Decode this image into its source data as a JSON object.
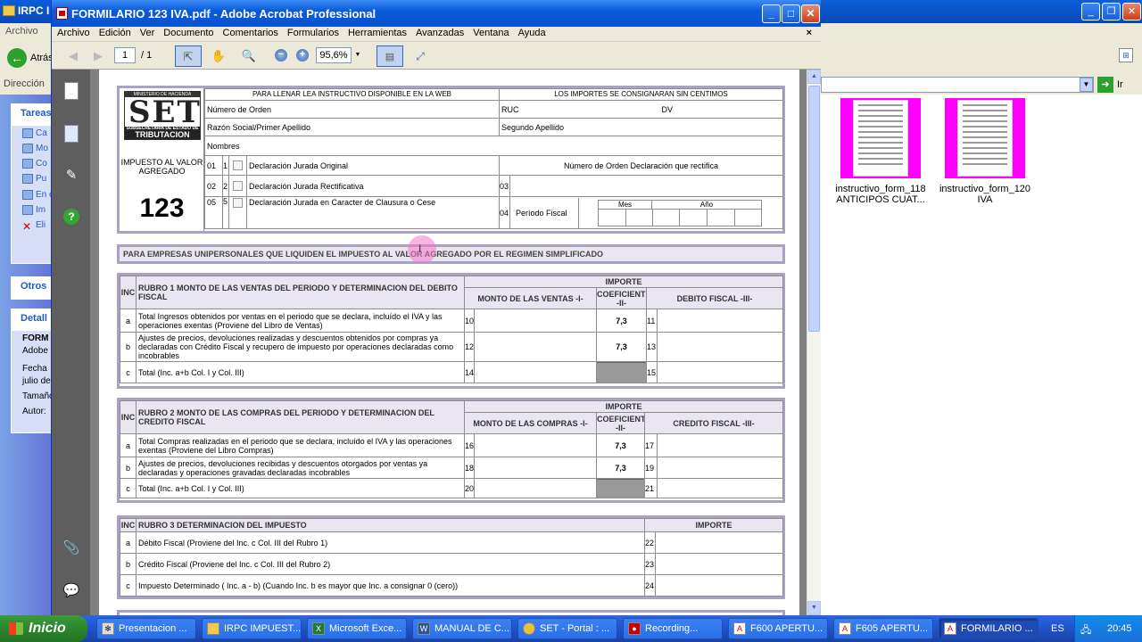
{
  "background": {
    "title": "IRPC I",
    "menu_label": "Archivo",
    "back_label": "Atrás",
    "address_label": "Dirección",
    "go_label": "Ir",
    "tasks_header": "Tareas",
    "task_items": [
      "Ca",
      "Mo",
      "Co",
      "Pu",
      "En el",
      "Im",
      "Eli"
    ],
    "others_header": "Otros",
    "details_header": "Detall",
    "details_lines": [
      "FORM",
      "Adobe",
      "Fecha",
      "julio de",
      "Tamaño",
      "Autor:"
    ],
    "thumbnails": [
      {
        "line1": "instructivo_form_118",
        "line2": "ANTICIPOS CUAT..."
      },
      {
        "line1": "instructivo_form_120",
        "line2": "IVA"
      }
    ]
  },
  "acrobat": {
    "title": "FORMILARIO 123 IVA.pdf - Adobe Acrobat Professional",
    "menu": [
      "Archivo",
      "Edición",
      "Ver",
      "Documento",
      "Comentarios",
      "Formularios",
      "Herramientas",
      "Avanzadas",
      "Ventana",
      "Ayuda"
    ],
    "close_x": "×",
    "page_current": "1",
    "page_total": "/ 1",
    "zoom": "95,6%"
  },
  "form": {
    "logo_top": "MINISTERIO DE HACIENDA",
    "logo_main": "SET",
    "logo_sub": "SUBSECRETARIA DE ESTADO DE",
    "logo_bottom": "TRIBUTACION",
    "tax_name": "IMPUESTO AL VALOR AGREGADO",
    "form_number": "123",
    "header_left": "PARA LLENAR LEA INSTRUCTIVO DISPONIBLE EN LA WEB",
    "header_right": "LOS IMPORTES SE CONSIGNARAN SIN CENTIMOS",
    "numero_orden": "Número de Orden",
    "ruc": "RUC",
    "dv": "DV",
    "razon_social": "Razón Social/Primer Apellido",
    "segundo_apellido": "Segundo Apellido",
    "nombres": "Nombres",
    "decl": [
      {
        "code": "01",
        "num": "1",
        "label": "Declaración Jurada Original"
      },
      {
        "code": "02",
        "num": "2",
        "label": "Declaración Jurada Rectificativa"
      },
      {
        "code": "05",
        "num": "5",
        "label": "Declaración Jurada en Caracter de Clausura o Cese"
      }
    ],
    "rectifica_label": "Número de Orden Declaración que rectifica",
    "code_03": "03",
    "code_04": "04",
    "periodo_fiscal": "Período Fiscal",
    "mes": "Mes",
    "anio": "Año",
    "simplificado": "PARA EMPRESAS UNIPERSONALES QUE LIQUIDEN EL IMPUESTO AL VALOR AGREGADO POR EL REGIMEN SIMPLIFICADO",
    "inc": "INC",
    "importe": "IMPORTE",
    "coeficiente": "COEFICIENTE -II-",
    "rubro1": {
      "title": "RUBRO 1 MONTO DE LAS VENTAS DEL PERIODO Y DETERMINACION DEL DEBITO FISCAL",
      "col1": "MONTO DE LAS VENTAS -I-",
      "col3": "DEBITO FISCAL -III-",
      "rows": [
        {
          "inc": "a",
          "text": "Total Ingresos obtenidos por ventas en el periodo que se declara, incluído el IVA y las operaciones exentas (Proviene del Libro de Ventas)",
          "n1": "10",
          "coef": "7,3",
          "n3": "11"
        },
        {
          "inc": "b",
          "text": "Ajustes de precios, devoluciones realizadas y descuentos obtenidos por compras ya declaradas con Crédito Fiscal y recupero de impuesto por operaciones declaradas como incobrables",
          "n1": "12",
          "coef": "7,3",
          "n3": "13"
        },
        {
          "inc": "c",
          "text": "Total (Inc. a+b Col. I y Col. III)",
          "n1": "14",
          "coef": "",
          "n3": "15"
        }
      ]
    },
    "rubro2": {
      "title": "RUBRO 2 MONTO DE LAS COMPRAS DEL PERIODO Y DETERMINACION DEL CREDITO FISCAL",
      "col1": "MONTO DE LAS COMPRAS -I-",
      "col3": "CREDITO FISCAL -III-",
      "rows": [
        {
          "inc": "a",
          "text": "Total Compras realizadas en el periodo que se declara, incluído el IVA y las operaciones exentas (Proviene del Libro Compras)",
          "n1": "16",
          "coef": "7,3",
          "n3": "17"
        },
        {
          "inc": "b",
          "text": "Ajustes de precios, devoluciones recibidas y descuentos otorgados por ventas ya declaradas y operaciones gravadas declaradas incobrables",
          "n1": "18",
          "coef": "7,3",
          "n3": "19"
        },
        {
          "inc": "c",
          "text": "Total (Inc. a+b Col. I y Col. III)",
          "n1": "20",
          "coef": "",
          "n3": "21"
        }
      ]
    },
    "rubro3": {
      "title": "RUBRO 3 DETERMINACION DEL IMPUESTO",
      "col": "IMPORTE",
      "rows": [
        {
          "inc": "a",
          "text": "Débito Fiscal (Proviene del Inc. c Col. III del Rubro 1)",
          "n": "22"
        },
        {
          "inc": "b",
          "text": "Crédito Fiscal (Proviene del Inc. c Col. III del Rubro 2)",
          "n": "23"
        },
        {
          "inc": "c",
          "text": "Impuesto Determinado ( Inc. a - b) (Cuando Inc. b es mayor que Inc. a consignar 0 (cero))",
          "n": "24"
        }
      ]
    }
  },
  "taskbar": {
    "start": "Inicio",
    "tasks": [
      "Presentacion ...",
      "IRPC IMPUEST...",
      "Microsoft Exce...",
      "MANUAL DE C...",
      "SET - Portal : ...",
      "Recording...",
      "F600 APERTU...",
      "F605 APERTU...",
      "FORMILARIO ..."
    ],
    "lang": "ES",
    "clock": "20:45"
  }
}
